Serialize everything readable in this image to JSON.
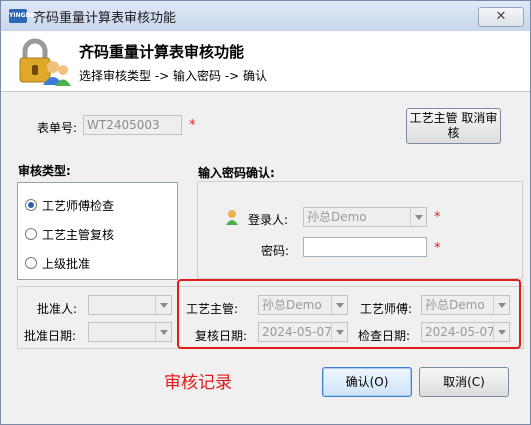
{
  "window": {
    "title": "齐码重量计算表审核功能",
    "app_icon_text": "YINGDE"
  },
  "header": {
    "title": "齐码重量计算表审核功能",
    "subtitle": "选择审核类型 -> 输入密码 -> 确认"
  },
  "form": {
    "order_label": "表单号:",
    "order_value": "WT2405003",
    "top_button_label": "工艺主管 取消审核"
  },
  "audit_type": {
    "label": "审核类型:",
    "options": [
      {
        "label": "工艺师傅检查",
        "checked": true
      },
      {
        "label": "工艺主管复核",
        "checked": false
      },
      {
        "label": "上级批准",
        "checked": false
      }
    ]
  },
  "password": {
    "label": "输入密码确认:",
    "user_label": "登录人:",
    "user_value": "孙总Demo",
    "password_label": "密码:",
    "password_value": ""
  },
  "approval": {
    "approver_label": "批准人:",
    "approver_value": "",
    "approve_date_label": "批准日期:",
    "approve_date_value": ""
  },
  "review": {
    "supervisor_label": "工艺主管:",
    "supervisor_value": "孙总Demo",
    "master_label": "工艺师傅:",
    "master_value": "孙总Demo",
    "review_date_label": "复核日期:",
    "review_date_value": "2024-05-07",
    "check_date_label": "检查日期:",
    "check_date_value": "2024-05-07"
  },
  "annotation": "审核记录",
  "buttons": {
    "ok": "确认(O)",
    "cancel": "取消(C)"
  },
  "required_mark": "*",
  "close_glyph": "✕",
  "colors": {
    "highlight": "#e31b1b",
    "accent": "#3c7fd6"
  }
}
